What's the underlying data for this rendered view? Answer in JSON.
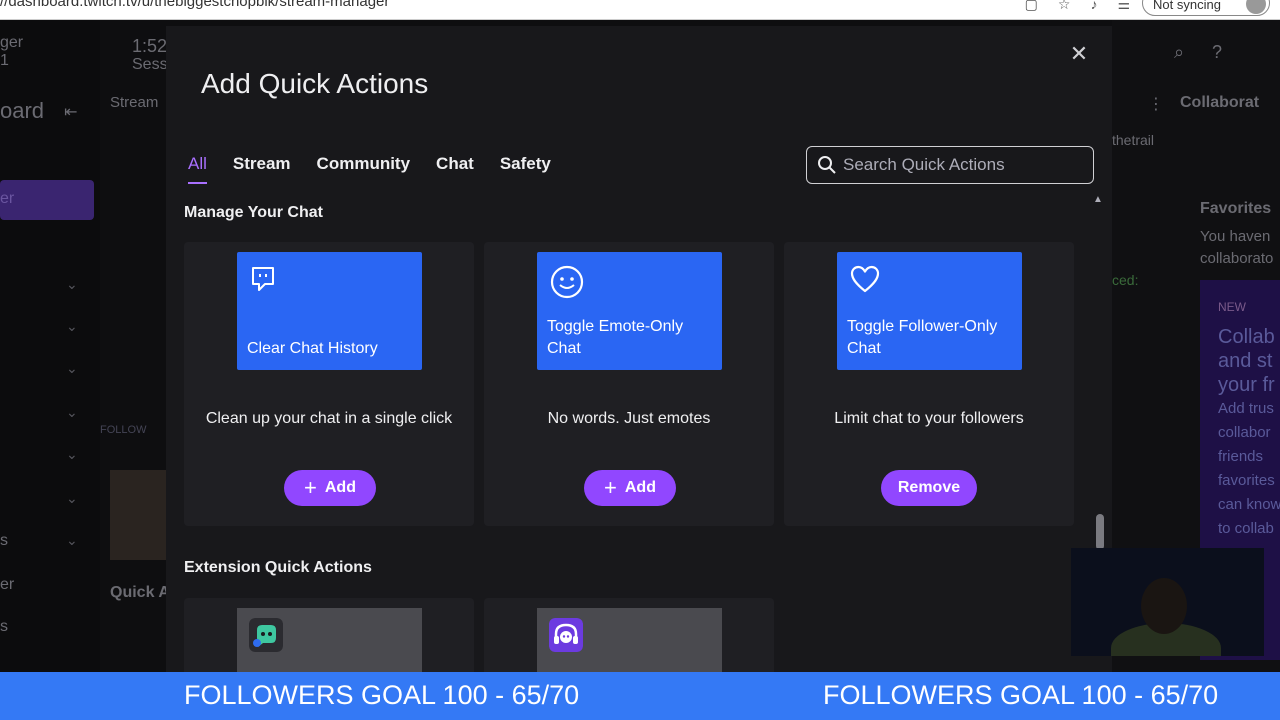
{
  "browser": {
    "url": "//dashboard.twitch.tv/u/thebiggestchopblk/stream-manager",
    "sync_label": "Not syncing"
  },
  "background": {
    "left_fragments": [
      "ger",
      "1",
      "oard",
      "er",
      "FOLLOW",
      "s",
      "er",
      "s"
    ],
    "center_fragments": [
      "1:52",
      "Sess",
      "Stream",
      "Quick A"
    ],
    "right_fragments": [
      "Collaborat",
      "thetrail",
      "Favorites",
      "You haven",
      "collaborato",
      "ced:",
      "NEW",
      "Collab",
      "and st",
      "your fr",
      "Add trus",
      "collabor",
      "friends",
      "favorites",
      "can know",
      "to collab"
    ]
  },
  "modal": {
    "title": "Add Quick Actions",
    "tabs": [
      {
        "label": "All",
        "active": true
      },
      {
        "label": "Stream",
        "active": false
      },
      {
        "label": "Community",
        "active": false
      },
      {
        "label": "Chat",
        "active": false
      },
      {
        "label": "Safety",
        "active": false
      }
    ],
    "search": {
      "placeholder": "Search Quick Actions",
      "value": ""
    },
    "sections": [
      {
        "title": "Manage Your Chat",
        "cards": [
          {
            "tile_label": "Clear Chat History",
            "icon": "chat-bubble-icon",
            "description": "Clean up your chat in a single click",
            "button": "Add",
            "button_plus": "+"
          },
          {
            "tile_label": "Toggle Emote-Only Chat",
            "icon": "smiley-icon",
            "description": "No words. Just emotes",
            "button": "Add",
            "button_plus": "+"
          },
          {
            "tile_label": "Toggle Follower-Only Chat",
            "icon": "heart-icon",
            "description": "Limit chat to your followers",
            "button": "Remove"
          }
        ]
      },
      {
        "title": "Extension Quick Actions",
        "cards": [
          {
            "icon": "extension-bot-icon"
          },
          {
            "icon": "extension-headphones-icon"
          }
        ]
      }
    ]
  },
  "ticker": {
    "text_left": "FOLLOWERS GOAL 100 - 65/70",
    "text_right": "FOLLOWERS GOAL 100 - 65/70"
  },
  "colors": {
    "accent": "#9147ff",
    "tab_active": "#a970ff",
    "tile": "#2a66f3",
    "ticker": "#3479f5"
  }
}
